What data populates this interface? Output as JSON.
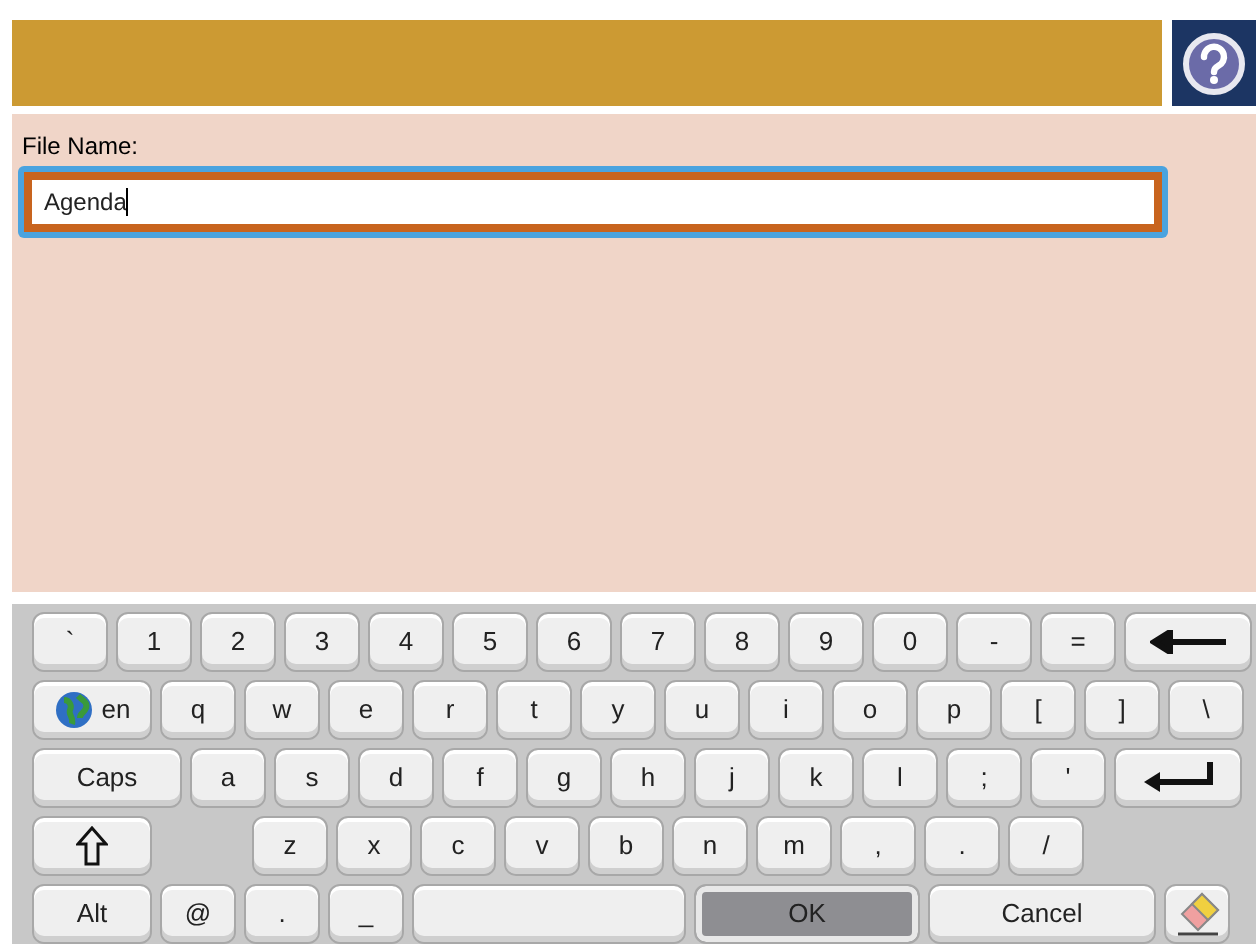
{
  "file_name": {
    "label": "File Name:",
    "value": "Agenda",
    "focused": true
  },
  "keyboard": {
    "rows": [
      {
        "keys": [
          {
            "kind": "char",
            "label": "`"
          },
          {
            "kind": "char",
            "label": "1"
          },
          {
            "kind": "char",
            "label": "2"
          },
          {
            "kind": "char",
            "label": "3"
          },
          {
            "kind": "char",
            "label": "4"
          },
          {
            "kind": "char",
            "label": "5"
          },
          {
            "kind": "char",
            "label": "6"
          },
          {
            "kind": "char",
            "label": "7"
          },
          {
            "kind": "char",
            "label": "8"
          },
          {
            "kind": "char",
            "label": "9"
          },
          {
            "kind": "char",
            "label": "0"
          },
          {
            "kind": "char",
            "label": "-"
          },
          {
            "kind": "char",
            "label": "="
          },
          {
            "kind": "backspace"
          }
        ]
      },
      {
        "keys": [
          {
            "kind": "language",
            "label": "en"
          },
          {
            "kind": "char",
            "label": "q"
          },
          {
            "kind": "char",
            "label": "w"
          },
          {
            "kind": "char",
            "label": "e"
          },
          {
            "kind": "char",
            "label": "r"
          },
          {
            "kind": "char",
            "label": "t"
          },
          {
            "kind": "char",
            "label": "y"
          },
          {
            "kind": "char",
            "label": "u"
          },
          {
            "kind": "char",
            "label": "i"
          },
          {
            "kind": "char",
            "label": "o"
          },
          {
            "kind": "char",
            "label": "p"
          },
          {
            "kind": "char",
            "label": "["
          },
          {
            "kind": "char",
            "label": "]"
          },
          {
            "kind": "char",
            "label": "\\"
          }
        ]
      },
      {
        "keys": [
          {
            "kind": "caps",
            "label": "Caps"
          },
          {
            "kind": "char",
            "label": "a"
          },
          {
            "kind": "char",
            "label": "s"
          },
          {
            "kind": "char",
            "label": "d"
          },
          {
            "kind": "char",
            "label": "f"
          },
          {
            "kind": "char",
            "label": "g"
          },
          {
            "kind": "char",
            "label": "h"
          },
          {
            "kind": "char",
            "label": "j"
          },
          {
            "kind": "char",
            "label": "k"
          },
          {
            "kind": "char",
            "label": "l"
          },
          {
            "kind": "char",
            "label": ";"
          },
          {
            "kind": "char",
            "label": "'"
          },
          {
            "kind": "enter"
          }
        ]
      },
      {
        "keys": [
          {
            "kind": "shift"
          },
          {
            "kind": "char",
            "label": "z"
          },
          {
            "kind": "char",
            "label": "x"
          },
          {
            "kind": "char",
            "label": "c"
          },
          {
            "kind": "char",
            "label": "v"
          },
          {
            "kind": "char",
            "label": "b"
          },
          {
            "kind": "char",
            "label": "n"
          },
          {
            "kind": "char",
            "label": "m"
          },
          {
            "kind": "char",
            "label": ","
          },
          {
            "kind": "char",
            "label": "."
          },
          {
            "kind": "char",
            "label": "/"
          }
        ]
      },
      {
        "keys": [
          {
            "kind": "alt",
            "label": "Alt"
          },
          {
            "kind": "char",
            "label": "@"
          },
          {
            "kind": "char",
            "label": "."
          },
          {
            "kind": "char",
            "label": "_"
          },
          {
            "kind": "space"
          },
          {
            "kind": "ok",
            "label": "OK"
          },
          {
            "kind": "cancel",
            "label": "Cancel"
          },
          {
            "kind": "eraser"
          }
        ]
      }
    ]
  }
}
